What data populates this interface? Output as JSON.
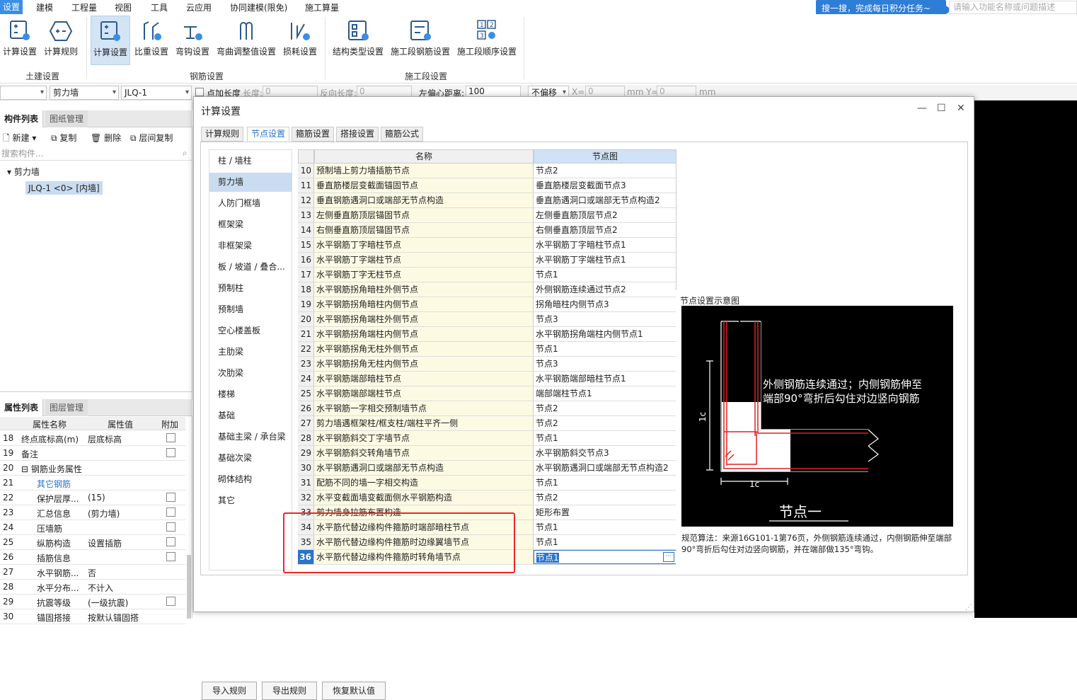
{
  "menubar": {
    "items": [
      "设置",
      "建模",
      "工程量",
      "视图",
      "工具",
      "云应用",
      "协同建模(限免)",
      "施工算量"
    ],
    "promo": "搜一搜，完成每日积分任务~",
    "search_placeholder": "请输入功能名称或问题描述"
  },
  "ribbon": {
    "buttons": [
      "计算设置",
      "计算规则",
      "计算设置",
      "比重设置",
      "弯钩设置",
      "弯曲调整值设置",
      "损耗设置",
      "结构类型设置",
      "施工段钢筋设置",
      "施工段顺序设置"
    ],
    "groups": [
      "土建设置",
      "钢筋设置",
      "施工段设置"
    ]
  },
  "toolrow": {
    "combo1": "",
    "combo2": "剪力墙",
    "combo3": "JLQ-1",
    "point_length": "点加长度",
    "length_label": "长度:",
    "length_val": "0",
    "backlen_label": "反向长度:",
    "backlen_val": "0",
    "offset_label": "左偏心距离:",
    "offset_val": "100",
    "nooffset": "不偏移",
    "x_label": "X=",
    "x_val": "0",
    "unit_y": "mm Y=",
    "y_val": "0",
    "unit": "mm"
  },
  "comp_panel": {
    "tabs": [
      "构件列表",
      "图纸管理"
    ],
    "new": "新建",
    "copy": "复制",
    "delete": "删除",
    "floor_copy": "层间复制",
    "search_placeholder": "搜索构件...",
    "tree_root": "剪力墙",
    "tree_item": "JLQ-1 <0> [内墙]"
  },
  "prop_panel": {
    "tabs": [
      "属性列表",
      "图层管理"
    ],
    "headers": [
      "属性名称",
      "属性值",
      "附加"
    ],
    "rows": [
      {
        "n": "18",
        "name": "终点底标高(m)",
        "val": "层底标高",
        "chk": true
      },
      {
        "n": "19",
        "name": "备注",
        "val": "",
        "chk": true
      },
      {
        "n": "20",
        "name": "⊟ 钢筋业务属性",
        "val": "",
        "chk": false
      },
      {
        "n": "21",
        "name": "其它钢筋",
        "val": "",
        "chk": false
      },
      {
        "n": "22",
        "name": "保护层厚...",
        "val": "(15)",
        "chk": true
      },
      {
        "n": "23",
        "name": "汇总信息",
        "val": "(剪力墙)",
        "chk": true
      },
      {
        "n": "24",
        "name": "压墙筋",
        "val": "",
        "chk": true
      },
      {
        "n": "25",
        "name": "纵筋构造",
        "val": "设置插筋",
        "chk": true
      },
      {
        "n": "26",
        "name": "插筋信息",
        "val": "",
        "chk": true
      },
      {
        "n": "27",
        "name": "水平钢筋...",
        "val": "否",
        "chk": false
      },
      {
        "n": "28",
        "name": "水平分布...",
        "val": "不计入",
        "chk": false
      },
      {
        "n": "29",
        "name": "抗震等级",
        "val": "(一级抗震)",
        "chk": true
      },
      {
        "n": "30",
        "name": "锚固搭接",
        "val": "按默认锚固搭",
        "chk": false
      }
    ]
  },
  "dialog": {
    "title": "计算设置",
    "tabs": [
      "计算规则",
      "节点设置",
      "箍筋设置",
      "搭接设置",
      "箍筋公式"
    ],
    "categories": [
      "柱 / 墙柱",
      "剪力墙",
      "人防门框墙",
      "框架梁",
      "非框架梁",
      "板 / 坡道 / 叠合...",
      "预制柱",
      "预制墙",
      "空心楼盖板",
      "主肋梁",
      "次肋梁",
      "楼梯",
      "基础",
      "基础主梁 / 承台梁",
      "基础次梁",
      "砌体结构",
      "其它"
    ],
    "grid_headers": [
      "名称",
      "节点图"
    ],
    "rows": [
      {
        "n": "10",
        "name": "预制墙上剪力墙插筋节点",
        "node": "节点2"
      },
      {
        "n": "11",
        "name": "垂直筋楼层变截面锚固节点",
        "node": "垂直筋楼层变截面节点3"
      },
      {
        "n": "12",
        "name": "垂直钢筋遇洞口或端部无节点构造",
        "node": "垂直筋遇洞口或端部无节点构造2"
      },
      {
        "n": "13",
        "name": "左侧垂直筋顶层锚固节点",
        "node": "左侧垂直筋顶层节点2"
      },
      {
        "n": "14",
        "name": "右侧垂直筋顶层锚固节点",
        "node": "右侧垂直筋顶层节点2"
      },
      {
        "n": "15",
        "name": "水平钢筋丁字暗柱节点",
        "node": "水平钢筋丁字暗柱节点1"
      },
      {
        "n": "16",
        "name": "水平钢筋丁字端柱节点",
        "node": "水平钢筋丁字端柱节点1"
      },
      {
        "n": "17",
        "name": "水平钢筋丁字无柱节点",
        "node": "节点1"
      },
      {
        "n": "18",
        "name": "水平钢筋拐角暗柱外侧节点",
        "node": "外侧钢筋连续通过节点2"
      },
      {
        "n": "19",
        "name": "水平钢筋拐角暗柱内侧节点",
        "node": "拐角暗柱内侧节点3"
      },
      {
        "n": "20",
        "name": "水平钢筋拐角端柱外侧节点",
        "node": "节点3"
      },
      {
        "n": "21",
        "name": "水平钢筋拐角端柱内侧节点",
        "node": "水平钢筋拐角端柱内侧节点1"
      },
      {
        "n": "22",
        "name": "水平钢筋拐角无柱外侧节点",
        "node": "节点1"
      },
      {
        "n": "23",
        "name": "水平钢筋拐角无柱内侧节点",
        "node": "节点3"
      },
      {
        "n": "24",
        "name": "水平钢筋端部暗柱节点",
        "node": "水平钢筋端部暗柱节点1"
      },
      {
        "n": "25",
        "name": "水平钢筋端部端柱节点",
        "node": "端部端柱节点1"
      },
      {
        "n": "26",
        "name": "水平钢筋一字相交预制墙节点",
        "node": "节点2"
      },
      {
        "n": "27",
        "name": "剪力墙遇框架柱/框支柱/端柱平齐一侧",
        "node": "节点2"
      },
      {
        "n": "28",
        "name": "水平钢筋斜交丁字墙节点",
        "node": "节点1"
      },
      {
        "n": "29",
        "name": "水平钢筋斜交转角墙节点",
        "node": "水平钢筋斜交节点3"
      },
      {
        "n": "30",
        "name": "水平钢筋遇洞口或端部无节点构造",
        "node": "水平钢筋遇洞口或端部无节点构造2"
      },
      {
        "n": "31",
        "name": "配筋不同的墙一字相交构造",
        "node": "节点1"
      },
      {
        "n": "32",
        "name": "水平变截面墙变截面侧水平钢筋构造",
        "node": "节点2"
      },
      {
        "n": "33",
        "name": "剪力墙身拉筋布置构造",
        "node": "矩形布置"
      },
      {
        "n": "34",
        "name": "水平筋代替边缘构件箍筋时端部暗柱节点",
        "node": "节点1"
      },
      {
        "n": "35",
        "name": "水平筋代替边缘构件箍筋时边缘翼墙节点",
        "node": "节点1"
      },
      {
        "n": "36",
        "name": "水平筋代替边缘构件箍筋时转角墙节点",
        "node": "节点1"
      }
    ],
    "preview_title": "节点设置示意图",
    "diagram_text1": "外侧钢筋连续通过；内侧钢筋伸至",
    "diagram_text2": "端部90°弯折后勾住对边竖向钢筋",
    "diagram_dim": "1c",
    "diagram_caption": "节点一",
    "algo": "规范算法：来源16G101-1第76页，外侧钢筋连续通过，内侧钢筋伸至端部90°弯折后勾住对边竖向钢筋，并在端部做135°弯钩。",
    "buttons": [
      "导入规则",
      "导出规则",
      "恢复默认值"
    ]
  },
  "colors": {
    "accent": "#2b74c9",
    "highlight": "#e8282b",
    "diagram_red": "#e02020"
  }
}
